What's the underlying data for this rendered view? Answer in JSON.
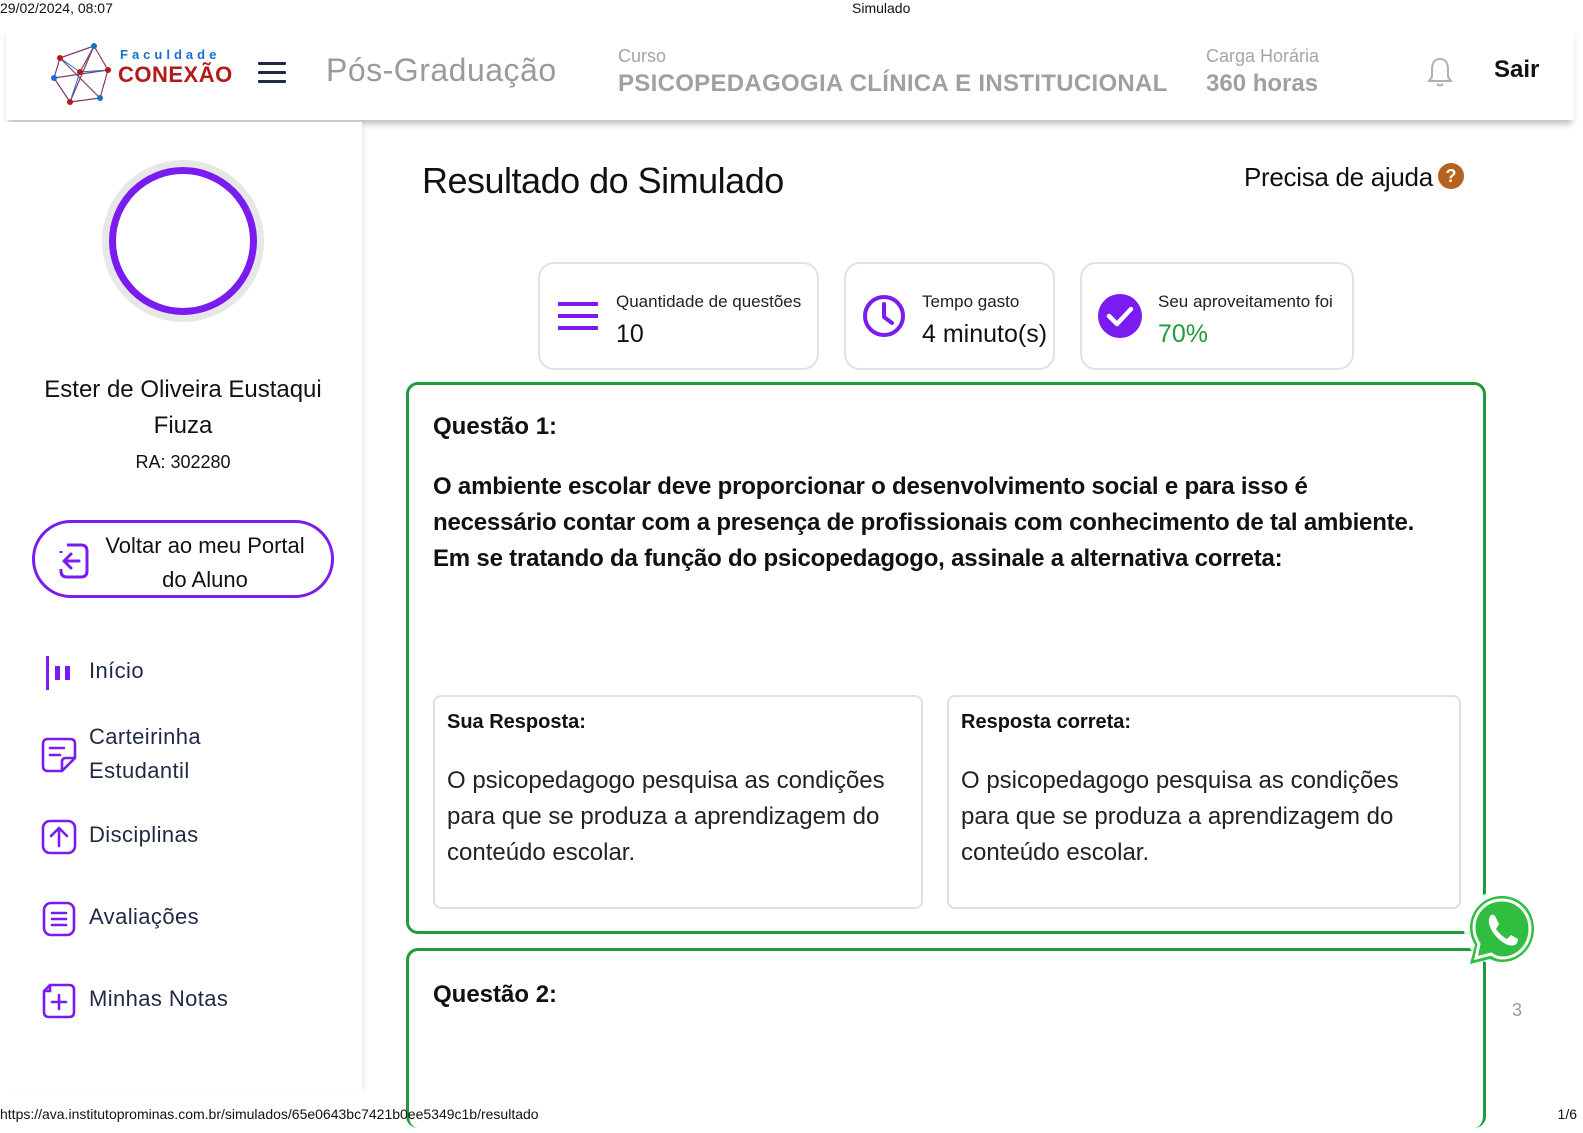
{
  "print": {
    "datetime": "29/02/2024, 08:07",
    "title": "Simulado",
    "url": "https://ava.institutoprominas.com.br/simulados/65e0643bc7421b0ee5349c1b/resultado",
    "page": "1/6"
  },
  "header": {
    "logo_small": "Faculdade",
    "logo_big": "CONEXÃO",
    "program": "Pós-Graduação",
    "course_label": "Curso",
    "course_value": "PSICOPEDAGOGIA CLÍNICA E INSTITUCIONAL",
    "hours_label": "Carga Horária",
    "hours_value": "360 horas",
    "logout": "Sair"
  },
  "sidebar": {
    "student_name": "Ester de Oliveira Eustaqui Fiuza",
    "ra": "RA: 302280",
    "portal_button": "Voltar ao meu Portal do Aluno",
    "items": [
      {
        "label": "Início",
        "icon": "bar-chart-icon"
      },
      {
        "label": "Carteirinha Estudantil",
        "icon": "id-card-icon"
      },
      {
        "label": "Disciplinas",
        "icon": "upload-icon"
      },
      {
        "label": "Avaliações",
        "icon": "list-icon"
      },
      {
        "label": "Minhas Notas",
        "icon": "plus-note-icon"
      }
    ]
  },
  "main": {
    "title": "Resultado do Simulado",
    "help": "Precisa de ajuda",
    "stats": [
      {
        "label": "Quantidade de questões",
        "value": "10",
        "icon": "list-lines-icon"
      },
      {
        "label": "Tempo gasto",
        "value": "4 minuto(s)",
        "icon": "clock-icon"
      },
      {
        "label": "Seu aproveitamento foi",
        "value": "70%",
        "icon": "check-circle-icon"
      }
    ],
    "questions": [
      {
        "title": "Questão 1:",
        "text": "O ambiente escolar deve proporcionar o desenvolvimento social e para isso é necessário contar com a presença de profissionais com conhecimento de tal ambiente. Em se tratando da função do psicopedagogo, assinale a alternativa correta:",
        "your_answer_label": "Sua Resposta:",
        "your_answer": "O psicopedagogo pesquisa as condições para que se produza a aprendizagem do conteúdo escolar.",
        "correct_answer_label": "Resposta correta:",
        "correct_answer": "O psicopedagogo pesquisa as condições para que se produza a aprendizagem do conteúdo escolar."
      },
      {
        "title": "Questão 2:"
      }
    ],
    "side_number": "3"
  },
  "colors": {
    "accent": "#7a1cf0",
    "success": "#1e9b3b",
    "help": "#b5621e"
  }
}
